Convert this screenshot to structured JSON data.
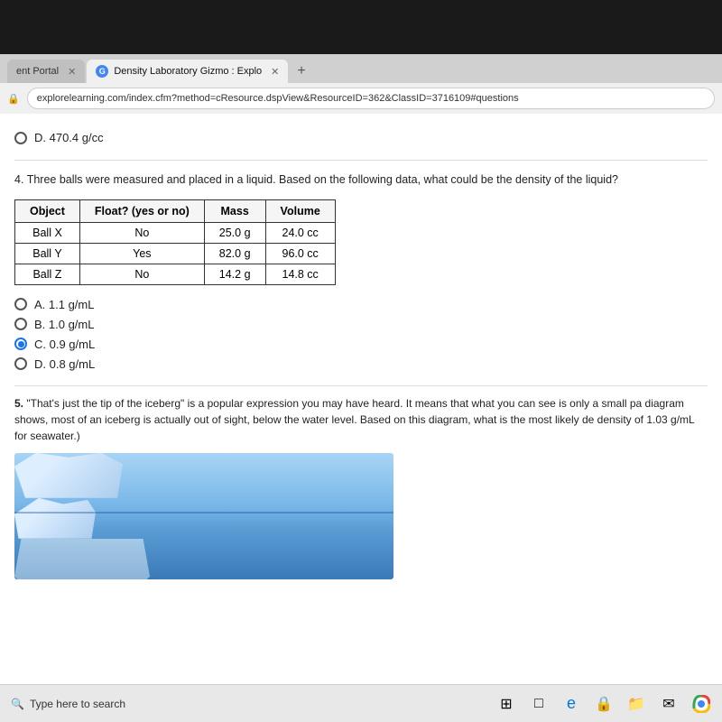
{
  "bezel": {
    "visible": true
  },
  "browser": {
    "tabs": [
      {
        "id": "tab-portal",
        "label": "ent Portal",
        "active": false,
        "icon": null
      },
      {
        "id": "tab-gizmo",
        "label": "Density Laboratory Gizmo : Explo",
        "active": true,
        "icon": "G"
      }
    ],
    "address": "explorelearning.com/index.cfm?method=cResource.dspView&ResourceID=362&ClassID=3716109#questions"
  },
  "content": {
    "prev_option": "D. 470.4 g/cc",
    "question4": {
      "number": "4.",
      "text": "Three balls were measured and placed in a liquid. Based on the following data, what could be the density of the liquid?"
    },
    "table": {
      "headers": [
        "Object",
        "Float? (yes or no)",
        "Mass",
        "Volume"
      ],
      "rows": [
        [
          "Ball X",
          "No",
          "25.0 g",
          "24.0 cc"
        ],
        [
          "Ball Y",
          "Yes",
          "82.0 g",
          "96.0 cc"
        ],
        [
          "Ball Z",
          "No",
          "14.2 g",
          "14.8 cc"
        ]
      ]
    },
    "options4": [
      {
        "id": "A",
        "label": "A. 1.1 g/mL",
        "selected": false
      },
      {
        "id": "B",
        "label": "B. 1.0 g/mL",
        "selected": false
      },
      {
        "id": "C",
        "label": "C. 0.9 g/mL",
        "selected": true
      },
      {
        "id": "D",
        "label": "D. 0.8 g/mL",
        "selected": false
      }
    ],
    "question5": {
      "number": "5.",
      "text": "\"That's just the tip of the iceberg\" is a popular expression you may have heard. It means that what you can see is only a small pa diagram shows, most of an iceberg is actually out of sight, below the water level. Based on this diagram, what is the most likely de density of 1.03 g/mL for seawater.)"
    }
  },
  "taskbar": {
    "search_placeholder": "Type here to search",
    "icons": [
      "⊞",
      "□",
      "e",
      "🔒",
      "📁",
      "✉",
      "⬤"
    ]
  }
}
